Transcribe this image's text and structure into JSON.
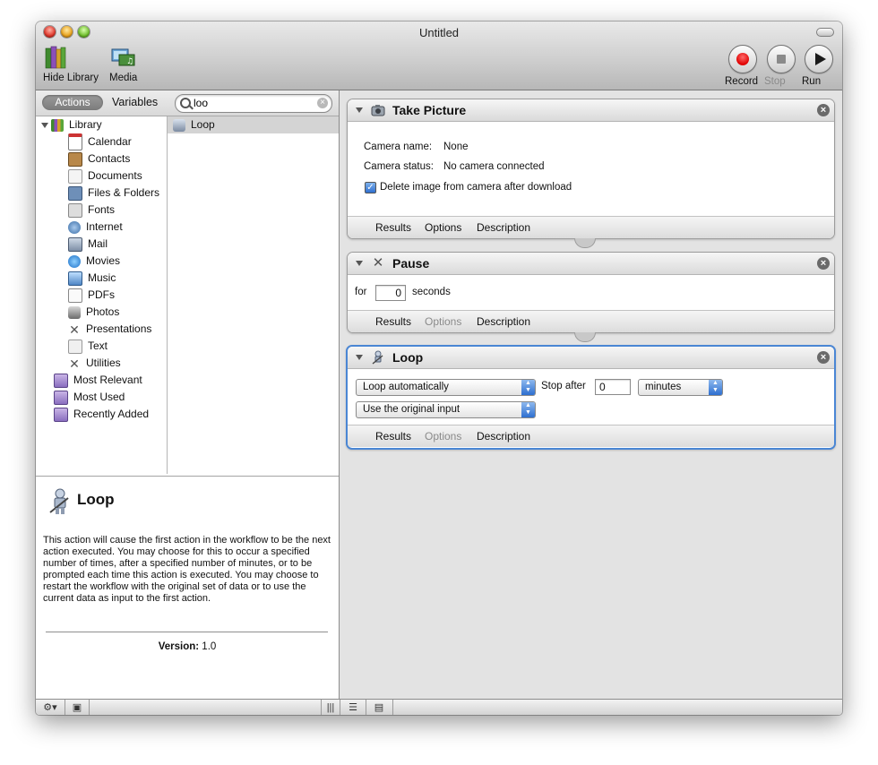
{
  "window": {
    "title": "Untitled"
  },
  "toolbar": {
    "hide_library": "Hide Library",
    "media": "Media",
    "record": "Record",
    "stop": "Stop",
    "run": "Run"
  },
  "library": {
    "tab_actions": "Actions",
    "tab_variables": "Variables",
    "search_value": "loo",
    "categories": [
      "Library",
      "Calendar",
      "Contacts",
      "Documents",
      "Files & Folders",
      "Fonts",
      "Internet",
      "Mail",
      "Movies",
      "Music",
      "PDFs",
      "Photos",
      "Presentations",
      "Text",
      "Utilities",
      "Most Relevant",
      "Most Used",
      "Recently Added"
    ],
    "result": "Loop"
  },
  "description": {
    "title": "Loop",
    "text": "This action will cause the first action in the workflow to be the next action executed. You may choose for this to occur a specified number of times, after a specified number of minutes, or to be prompted each time this action is executed. You may choose to restart the workflow with the original set of data or to use the current data as input to the first action.",
    "version_label": "Version:",
    "version_value": "1.0"
  },
  "footer_tabs": {
    "results": "Results",
    "options": "Options",
    "description": "Description"
  },
  "take_picture": {
    "title": "Take Picture",
    "camera_name_label": "Camera name:",
    "camera_name_value": "None",
    "camera_status_label": "Camera status:",
    "camera_status_value": "No camera connected",
    "delete_label": "Delete image from camera after download",
    "delete_checked": true
  },
  "pause": {
    "title": "Pause",
    "for_label": "for",
    "seconds_value": "0",
    "seconds_label": "seconds"
  },
  "loop": {
    "title": "Loop",
    "mode_value": "Loop automatically",
    "stop_after_label": "Stop after",
    "stop_after_value": "0",
    "unit_value": "minutes",
    "input_value": "Use the original input"
  },
  "colors": {
    "accent": "#4a86d4",
    "record": "#e00000"
  }
}
